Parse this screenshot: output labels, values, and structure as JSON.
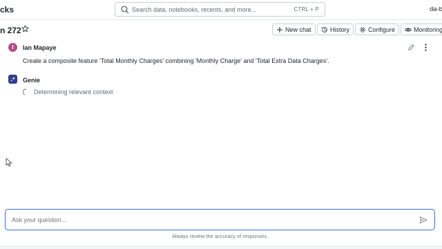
{
  "header": {
    "brand_partial": "cks",
    "search_placeholder": "Search data, notebooks, recents, and more...",
    "search_shortcut": "CTRL + P",
    "user_partial": "da-b"
  },
  "space": {
    "title_partial": "n 272",
    "buttons": {
      "new_chat": "New chat",
      "history": "History",
      "configure": "Configure",
      "monitoring": "Monitoring"
    }
  },
  "conversation": {
    "user": {
      "initial": "I",
      "name": "Ian Mapaye",
      "message": "Create a composite feature 'Total Monthly Charges' combining 'Monthly Charge' and 'Total Extra Data Charges'.",
      "avatar_color": "#b34e86"
    },
    "assistant": {
      "name": "Genie",
      "status": "Determining relevant context",
      "avatar_color": "#2e3f8f"
    }
  },
  "composer": {
    "placeholder": "Ask your question...",
    "disclaimer": "Always review the accuracy of responses."
  },
  "colors": {
    "accent": "#2f6fd4",
    "border": "#c9ced4"
  }
}
